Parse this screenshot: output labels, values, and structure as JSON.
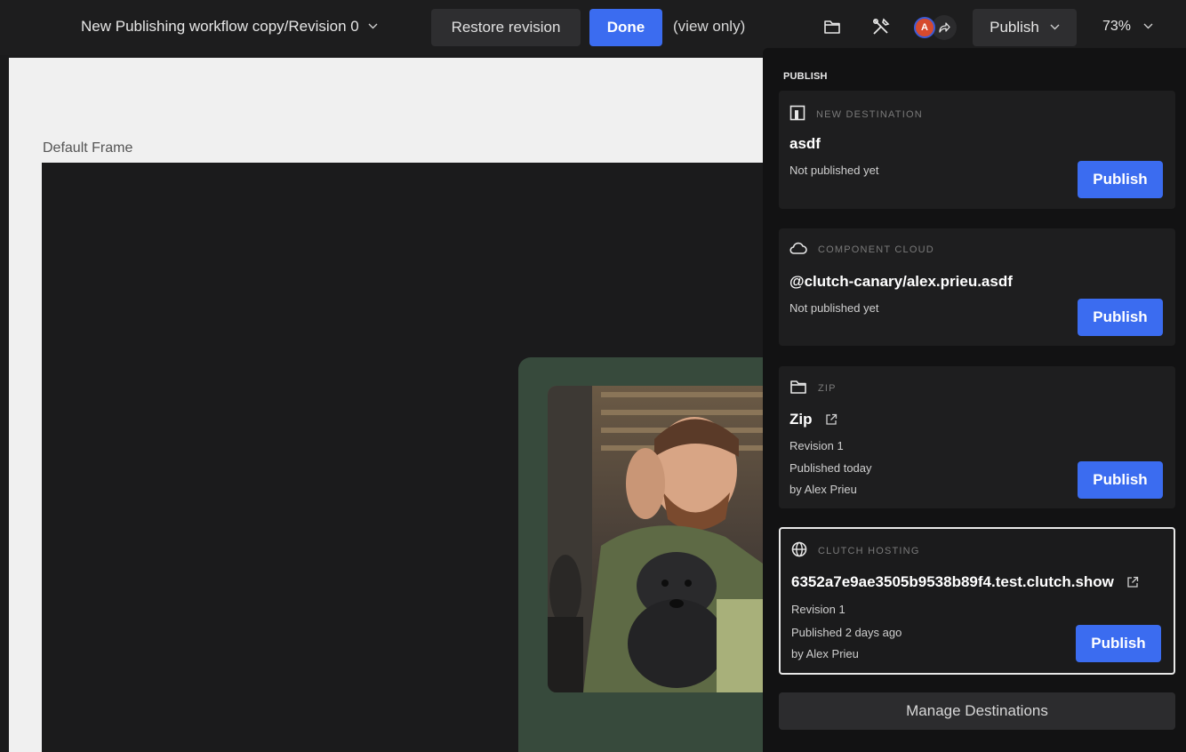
{
  "topbar": {
    "doc_title": "New Publishing workflow copy/Revision 0",
    "restore_label": "Restore revision",
    "done_label": "Done",
    "view_only": "(view only)",
    "avatar_initial": "A",
    "publish_label": "Publish",
    "zoom": "73%"
  },
  "canvas": {
    "frame_label": "Default Frame"
  },
  "publish_panel": {
    "heading": "PUBLISH",
    "destinations": [
      {
        "type": "NEW DESTINATION",
        "icon": "new-destination-icon",
        "name": "asdf",
        "status": "Not published yet",
        "button": "Publish"
      },
      {
        "type": "COMPONENT CLOUD",
        "icon": "cloud-icon",
        "name": "@clutch-canary/alex.prieu.asdf",
        "status": "Not published yet",
        "button": "Publish"
      },
      {
        "type": "ZIP",
        "icon": "folder-icon",
        "name": "Zip",
        "revision": "Revision 1",
        "published": "Published today",
        "by": "by Alex Prieu",
        "button": "Publish"
      },
      {
        "type": "CLUTCH HOSTING",
        "icon": "globe-icon",
        "name": "6352a7e9ae3505b9538b89f4.test.clutch.show",
        "revision": "Revision 1",
        "published": "Published 2 days ago",
        "by": "by Alex Prieu",
        "button": "Publish"
      }
    ],
    "manage_label": "Manage Destinations"
  },
  "colors": {
    "accent": "#3b6cf0",
    "panel_bg": "#121213",
    "card_bg": "#374a3c"
  }
}
